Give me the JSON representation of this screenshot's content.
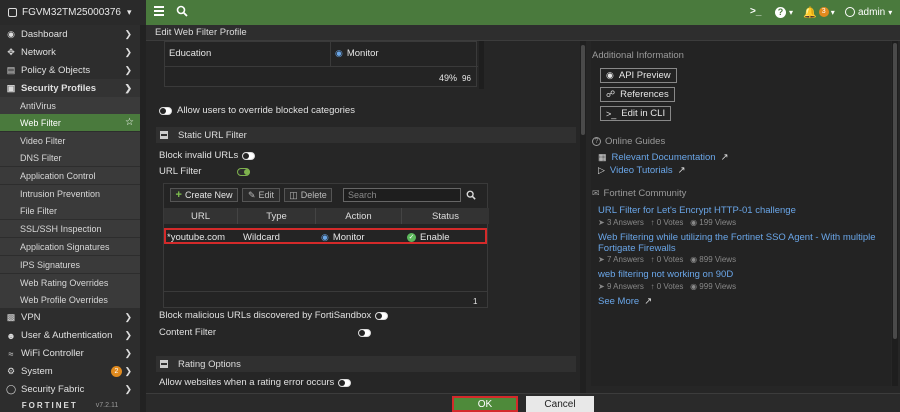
{
  "device": {
    "name": "FGVM32TM25000376"
  },
  "topbar": {
    "menu_icon": "hamburger-icon",
    "search_icon": "search-icon",
    "cli_label": ">_",
    "help_label": "?",
    "alert_count": "3",
    "user": "admin"
  },
  "sidebar": {
    "items": [
      {
        "label": "Dashboard",
        "icon": "dashboard-icon"
      },
      {
        "label": "Network",
        "icon": "network-icon"
      },
      {
        "label": "Policy & Objects",
        "icon": "policy-icon"
      },
      {
        "label": "Security Profiles",
        "icon": "lock-icon"
      },
      {
        "label": "VPN",
        "icon": "monitor-icon"
      },
      {
        "label": "User & Authentication",
        "icon": "user-icon"
      },
      {
        "label": "WiFi Controller",
        "icon": "wifi-icon"
      },
      {
        "label": "System",
        "icon": "gear-icon",
        "badge": "2"
      },
      {
        "label": "Security Fabric",
        "icon": "fabric-icon"
      }
    ],
    "sub_items": [
      {
        "label": "AntiVirus"
      },
      {
        "label": "Web Filter"
      },
      {
        "label": "Video Filter"
      },
      {
        "label": "DNS Filter"
      },
      {
        "label": "Application Control"
      },
      {
        "label": "Intrusion Prevention"
      },
      {
        "label": "File Filter"
      },
      {
        "label": "SSL/SSH Inspection"
      },
      {
        "label": "Application Signatures"
      },
      {
        "label": "IPS Signatures"
      },
      {
        "label": "Web Rating Overrides"
      },
      {
        "label": "Web Profile Overrides"
      }
    ],
    "brand": "FORTINET",
    "version": "v7.2.11"
  },
  "page": {
    "title": "Edit Web Filter Profile"
  },
  "categories": {
    "row_label": "Education",
    "row_action": "Monitor",
    "percent": "49%",
    "count": "96"
  },
  "override": {
    "label": "Allow users to override blocked categories"
  },
  "static_url": {
    "title": "Static URL Filter",
    "block_invalid": "Block invalid URLs",
    "url_filter": "URL Filter",
    "create_new": "Create New",
    "edit": "Edit",
    "delete": "Delete",
    "search_placeholder": "Search",
    "columns": [
      "URL",
      "Type",
      "Action",
      "Status"
    ],
    "rows": [
      {
        "url": "*youtube.com",
        "type": "Wildcard",
        "action": "Monitor",
        "status": "Enable"
      }
    ],
    "footer_count": "1",
    "block_malicious": "Block malicious URLs discovered by FortiSandbox",
    "content_filter": "Content Filter"
  },
  "rating": {
    "title": "Rating Options",
    "allow_error": "Allow websites when a rating error occurs"
  },
  "right_panel": {
    "additional_info": "Additional Information",
    "api_preview": "API Preview",
    "references": "References",
    "edit_cli": "Edit in CLI",
    "online_guides": "Online Guides",
    "relevant_doc": "Relevant Documentation",
    "video_tutorials": "Video Tutorials",
    "community": "Fortinet Community",
    "posts": [
      {
        "title": "URL Filter for Let's Encrypt HTTP-01 challenge",
        "answers": "3 Answers",
        "votes": "0 Votes",
        "views": "199 Views"
      },
      {
        "title": "Web Filtering while utilizing the Fortinet SSO Agent - With multiple",
        "title2": "Fortigate Firewalls",
        "answers": "7 Answers",
        "votes": "0 Votes",
        "views": "899 Views"
      },
      {
        "title": "web filtering not working on 90D",
        "answers": "9 Answers",
        "votes": "0 Votes",
        "views": "999 Views"
      }
    ],
    "see_more": "See More"
  },
  "footer": {
    "ok": "OK",
    "cancel": "Cancel"
  },
  "colors": {
    "header_green": "#4a7a3d",
    "active_green": "#4a7a3d",
    "link_blue": "#6aa6e8",
    "highlight_red": "#d42a2a",
    "toggle_green": "#7fb24e"
  }
}
